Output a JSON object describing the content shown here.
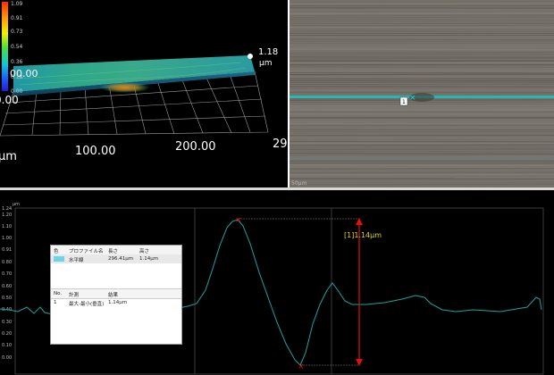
{
  "view3d": {
    "colorbar_ticks": [
      "1.09",
      "0.91",
      "0.73",
      "0.54",
      "0.36",
      "0.18",
      "0.00"
    ],
    "colorbar_overlay": "00.00",
    "peak_label": "1.18",
    "peak_unit": "µm",
    "axis_left": "0.00",
    "axis_ticks": [
      "100.00",
      "200.00",
      "29"
    ],
    "axis_unit": "µm"
  },
  "image_view": {
    "marker_label": "1",
    "corner_label": "50µm"
  },
  "profile": {
    "y_unit": "µm",
    "y_ticks": [
      "1.24",
      "1.20",
      "1.10",
      "1.00",
      "0.91",
      "0.80",
      "0.70",
      "0.60",
      "0.50",
      "0.40",
      "0.30",
      "0.20",
      "0.10",
      "0.00"
    ],
    "measure_label": "[1]1.14µm",
    "colors": {
      "profile_line": "#1fa3a0",
      "measure": "#e01010",
      "measure_text": "#e8d21a"
    }
  },
  "info_table": {
    "headers": [
      "色",
      "プロファイル名",
      "長さ",
      "高さ"
    ],
    "row": {
      "name": "水平線",
      "length": "296.41µm",
      "height": "1.14µm"
    },
    "headers2": [
      "No.",
      "計測",
      "結果"
    ],
    "measure_row": {
      "no": "1",
      "type": "最大-最小(垂直)",
      "result": "1.14µm"
    }
  }
}
